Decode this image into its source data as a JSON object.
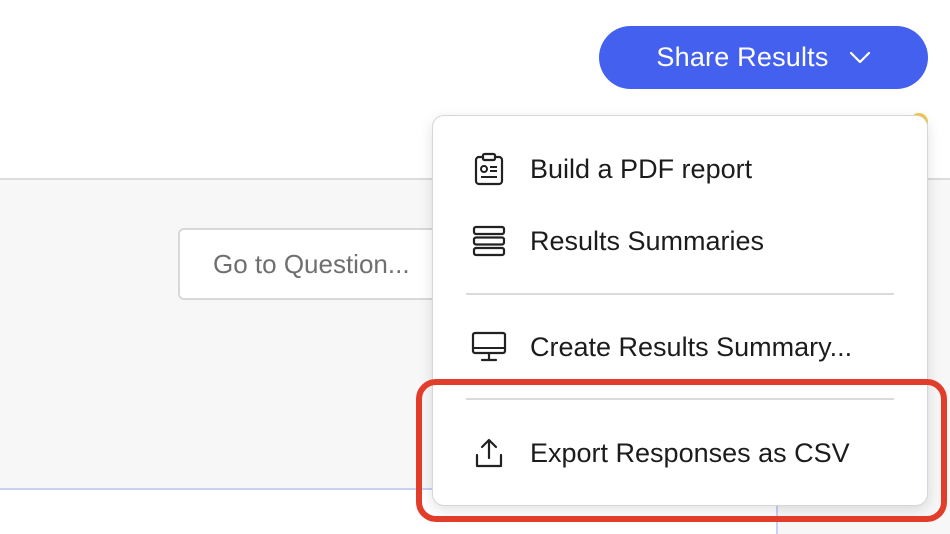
{
  "header": {
    "share_button": {
      "label": "Share Results",
      "icon": "chevron-down-icon"
    }
  },
  "toolbar": {
    "goto_question": {
      "label": "Go to Question..."
    }
  },
  "share_menu": {
    "items": [
      {
        "label": "Build a PDF report",
        "icon": "clipboard-report-icon"
      },
      {
        "label": "Results Summaries",
        "icon": "stacked-list-icon"
      },
      {
        "label": "Create Results Summary...",
        "icon": "monitor-icon"
      },
      {
        "label": "Export Responses as CSV",
        "icon": "upload-icon"
      }
    ]
  },
  "colors": {
    "accent": "#4361ee",
    "highlight": "#e23c2a",
    "notification_dot": "#f2c94c"
  }
}
